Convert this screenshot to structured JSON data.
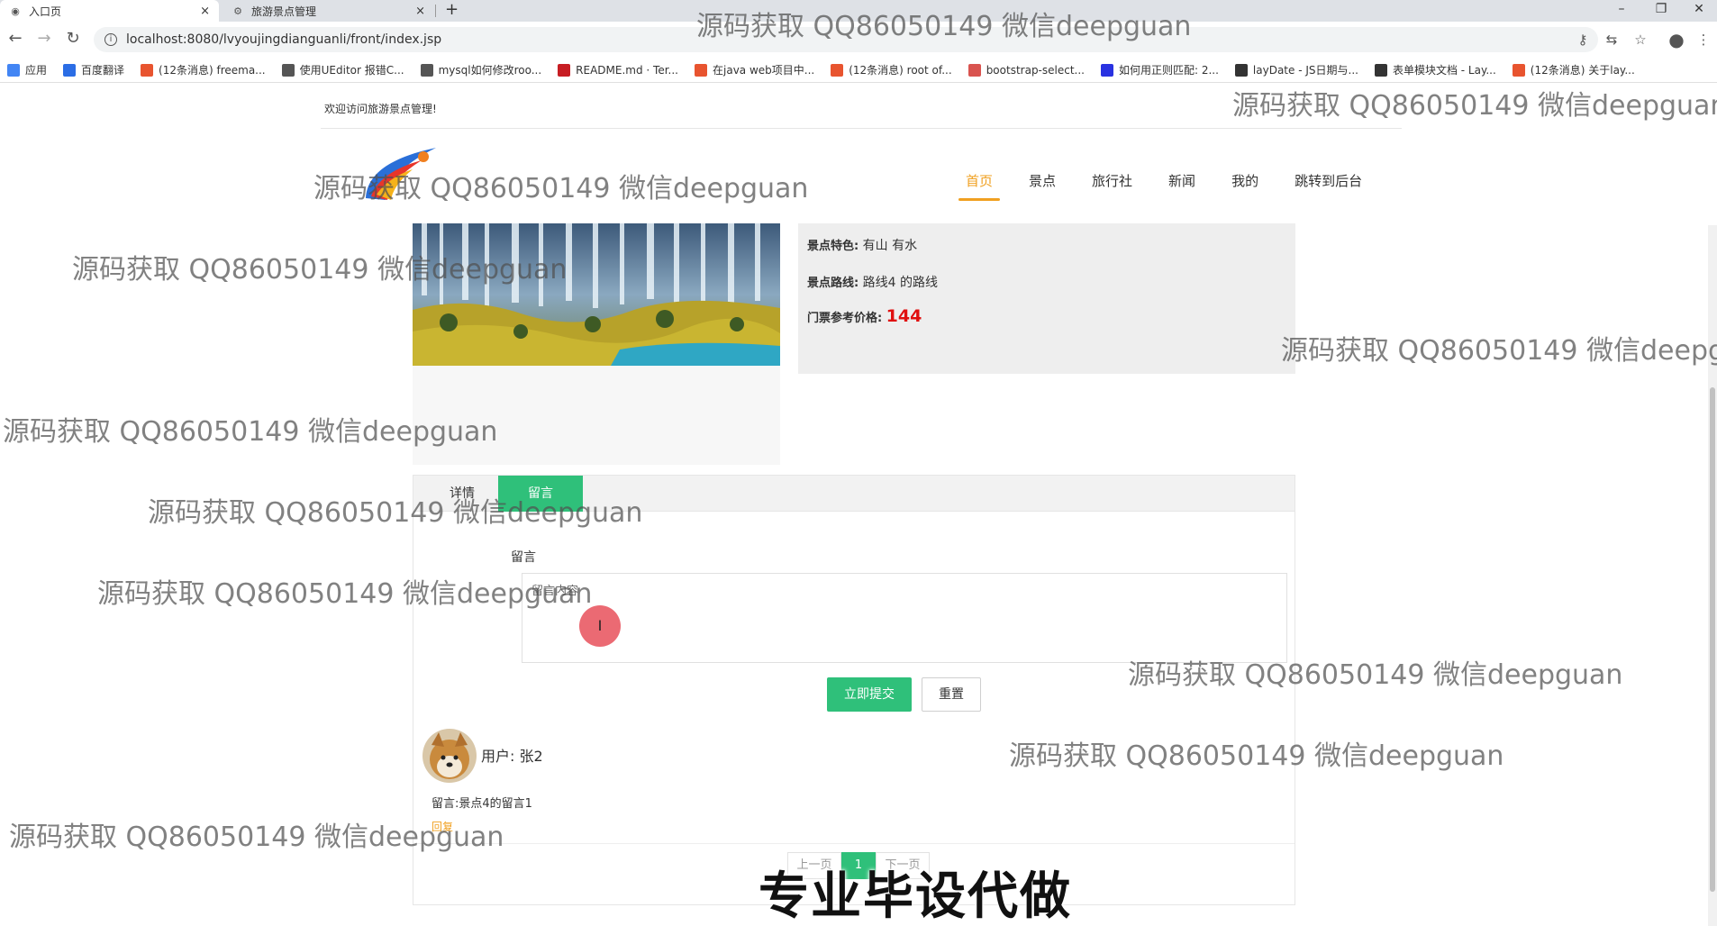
{
  "browser": {
    "tabs": [
      {
        "title": "入口页",
        "close": "×"
      },
      {
        "title": "旅游景点管理",
        "close": "×"
      }
    ],
    "new_tab": "+",
    "window_controls": [
      "–",
      "❐",
      "✕"
    ],
    "url": "localhost:8080/lvyoujingdianguanli/front/index.jsp",
    "bookmarks": [
      {
        "label": "应用",
        "icon": "apps-grid-icon",
        "color": "#4285f4"
      },
      {
        "label": "百度翻译",
        "icon": "baidu-translate-icon",
        "color": "#2b6de5"
      },
      {
        "label": "(12条消息) freema...",
        "icon": "csdn-icon",
        "color": "#e8542f"
      },
      {
        "label": "使用UEditor 报错C...",
        "icon": "ueditor-icon",
        "color": "#555555"
      },
      {
        "label": "mysql如何修改roo...",
        "icon": "mysql-icon",
        "color": "#555555"
      },
      {
        "label": "README.md · Ter...",
        "icon": "gitee-icon",
        "color": "#c71d23"
      },
      {
        "label": "在java web项目中...",
        "icon": "csdn-icon",
        "color": "#e8542f"
      },
      {
        "label": "(12条消息) root of...",
        "icon": "csdn-icon",
        "color": "#e8542f"
      },
      {
        "label": "bootstrap-select...",
        "icon": "bootstrap-icon",
        "color": "#d9534f"
      },
      {
        "label": "如何用正则匹配: 2...",
        "icon": "baidu-icon",
        "color": "#2932e1"
      },
      {
        "label": "layDate - JS日期与...",
        "icon": "layui-icon",
        "color": "#333333"
      },
      {
        "label": "表单模块文档 - Lay...",
        "icon": "layui-icon",
        "color": "#333333"
      },
      {
        "label": "(12条消息) 关于lay...",
        "icon": "csdn-icon",
        "color": "#e8542f"
      }
    ]
  },
  "header": {
    "welcome": "欢迎访问旅游景点管理!",
    "nav": [
      "首页",
      "景点",
      "旅行社",
      "新闻",
      "我的",
      "跳转到后台"
    ],
    "active_nav": "首页"
  },
  "detail": {
    "features_label": "景点特色:",
    "features_value": "有山 有水",
    "route_label": "景点路线:",
    "route_value": "路线4 的路线",
    "price_label": "门票参考价格:",
    "price_value": "144"
  },
  "tabs": {
    "detail": "详情",
    "message": "留言"
  },
  "message_form": {
    "label": "留言",
    "textarea_value": "留言内容",
    "submit": "立即提交",
    "reset": "重置",
    "cursor_glyph": "I"
  },
  "comments": [
    {
      "user_label": "用户:",
      "user": "张2",
      "text": "留言:景点4的留言1",
      "reply": "回复"
    }
  ],
  "pagination": {
    "prev": "上一页",
    "current": "1",
    "next": "下一页"
  },
  "watermark": "源码获取 QQ86050149 微信deepguan",
  "watermark_cut": "源码获取 QQ86050149 微信deepg",
  "banner": "专业毕设代做",
  "colors": {
    "accent_green": "#2fc07a",
    "nav_active": "#f0a020",
    "price_red": "#e01010"
  }
}
